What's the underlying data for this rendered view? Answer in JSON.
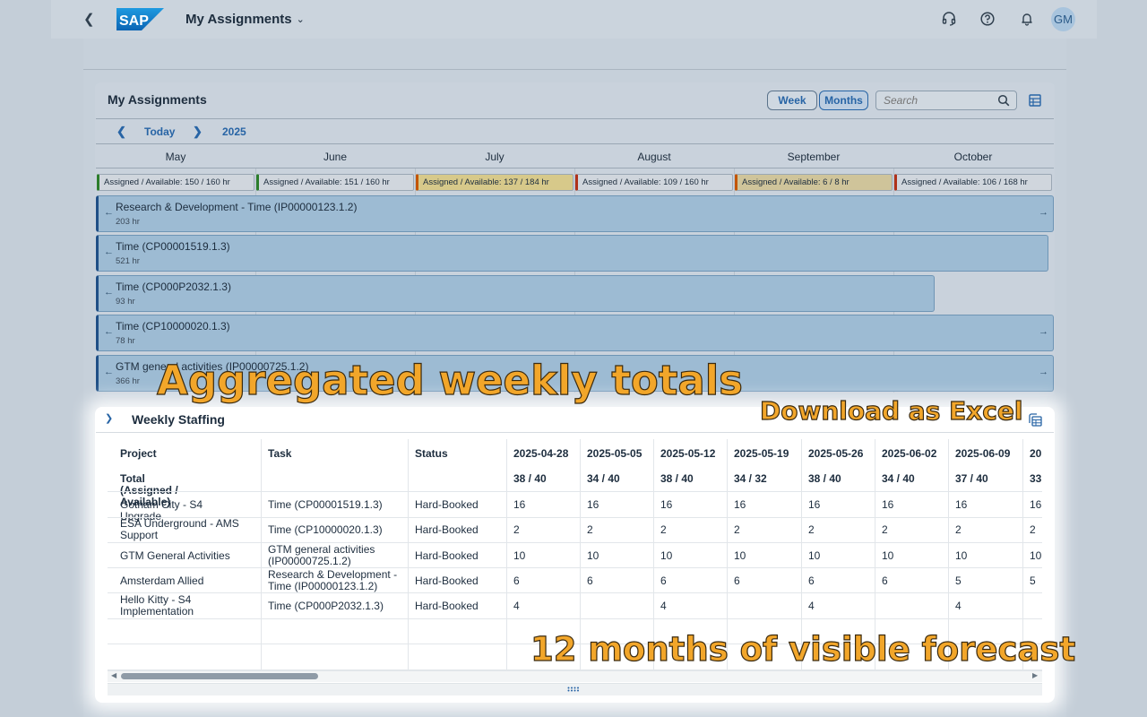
{
  "shell": {
    "app_title": "My Assignments",
    "avatar_initials": "GM"
  },
  "assignments": {
    "title": "My Assignments",
    "view_week": "Week",
    "view_months": "Months",
    "search_placeholder": "Search",
    "today_label": "Today",
    "year_label": "2025",
    "months": [
      "May",
      "June",
      "July",
      "August",
      "September",
      "October"
    ],
    "utilization": [
      {
        "text": "Assigned / Available: 150 / 160 hr",
        "status": "green"
      },
      {
        "text": "Assigned / Available: 151 / 160 hr",
        "status": "green"
      },
      {
        "text": "Assigned / Available: 137 / 184 hr",
        "status": "yellow"
      },
      {
        "text": "Assigned / Available: 109 / 160 hr",
        "status": "red"
      },
      {
        "text": "Assigned / Available: 6 / 8 hr",
        "status": "orange"
      },
      {
        "text": "Assigned / Available: 106 / 168 hr",
        "status": "red"
      }
    ],
    "bars": [
      {
        "name": "Research & Development - Time (IP00000123.1.2)",
        "hours": "203 hr"
      },
      {
        "name": "Time (CP00001519.1.3)",
        "hours": "521 hr"
      },
      {
        "name": "Time (CP000P2032.1.3)",
        "hours": "93 hr"
      },
      {
        "name": "Time (CP10000020.1.3)",
        "hours": "78 hr"
      },
      {
        "name": "GTM general activities (IP00000725.1.2)",
        "hours": "366 hr"
      }
    ]
  },
  "callouts": {
    "aggregated": "Aggregated weekly totals",
    "download": "Download as Excel",
    "forecast": "12 months of visible forecast"
  },
  "staffing": {
    "title": "Weekly Staffing",
    "headers": {
      "project": "Project",
      "task": "Task",
      "status": "Status",
      "total_label": "Total (Assigned / Available)"
    },
    "weeks": [
      "2025-04-28",
      "2025-05-05",
      "2025-05-12",
      "2025-05-19",
      "2025-05-26",
      "2025-06-02",
      "2025-06-09",
      "20"
    ],
    "totals": [
      "38 / 40",
      "34 / 40",
      "38 / 40",
      "34 / 32",
      "38 / 40",
      "34 / 40",
      "37 / 40",
      "33"
    ],
    "rows": [
      {
        "project": "Gotham City - S4 Upgrade",
        "task": "Time (CP00001519.1.3)",
        "status": "Hard-Booked",
        "values": [
          "16",
          "16",
          "16",
          "16",
          "16",
          "16",
          "16",
          "16"
        ]
      },
      {
        "project": "ESA Underground - AMS Support",
        "task": "Time (CP10000020.1.3)",
        "status": "Hard-Booked",
        "values": [
          "2",
          "2",
          "2",
          "2",
          "2",
          "2",
          "2",
          "2"
        ]
      },
      {
        "project": "GTM General Activities",
        "task": "GTM general activities (IP00000725.1.2)",
        "status": "Hard-Booked",
        "values": [
          "10",
          "10",
          "10",
          "10",
          "10",
          "10",
          "10",
          "10"
        ]
      },
      {
        "project": "Amsterdam Allied",
        "task": "Research & Development - Time (IP00000123.1.2)",
        "status": "Hard-Booked",
        "values": [
          "6",
          "6",
          "6",
          "6",
          "6",
          "6",
          "5",
          "5"
        ]
      },
      {
        "project": "Hello Kitty - S4 Implementation",
        "task": "Time (CP000P2032.1.3)",
        "status": "Hard-Booked",
        "values": [
          "4",
          "",
          "4",
          "",
          "4",
          "",
          "4",
          ""
        ]
      }
    ]
  }
}
